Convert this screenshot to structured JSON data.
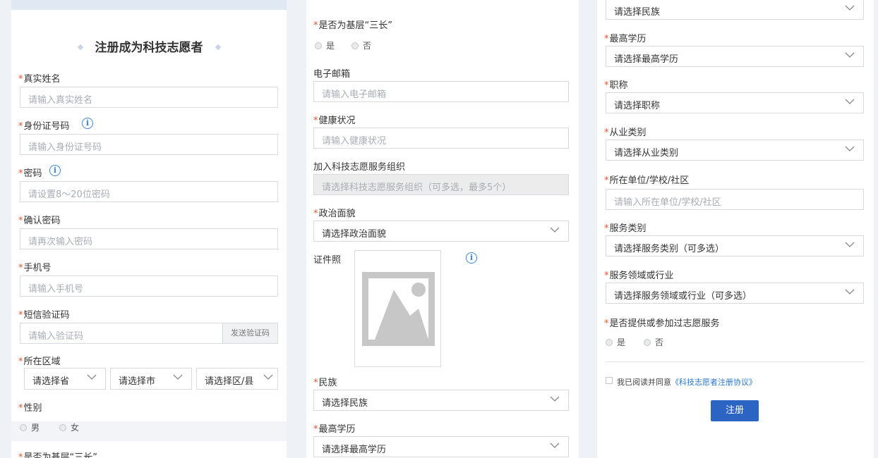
{
  "left_panel": {
    "title": "注册成为科技志愿者",
    "fields": {
      "real_name": {
        "label": "真实姓名",
        "placeholder": "请输入真实姓名"
      },
      "id_number": {
        "label": "身份证号码",
        "placeholder": "请输入身份证号码"
      },
      "password": {
        "label": "密码",
        "placeholder": "请设置8～20位密码"
      },
      "confirm_password": {
        "label": "确认密码",
        "placeholder": "请再次输入密码"
      },
      "phone": {
        "label": "手机号",
        "placeholder": "请输入手机号"
      },
      "sms_code": {
        "label": "短信验证码",
        "placeholder": "请输入验证码",
        "send_button": "发送验证码"
      },
      "region": {
        "label": "所在区域",
        "province": "请选择省",
        "city": "请选择市",
        "district": "请选择区/县"
      },
      "gender": {
        "label": "性别",
        "options": [
          "男",
          "女"
        ]
      },
      "grassroots_cut": {
        "label": "是否为基层“三长”"
      }
    }
  },
  "middle_panel": {
    "grassroots": {
      "label": "是否为基层“三长”",
      "options": [
        "是",
        "否"
      ]
    },
    "email": {
      "label": "电子邮箱",
      "placeholder": "请输入电子邮箱"
    },
    "health": {
      "label": "健康状况",
      "placeholder": "请输入健康状况"
    },
    "organization": {
      "label": "加入科技志愿服务组织",
      "placeholder": "请选择科技志愿服务组织（可多选，最多5个）"
    },
    "political": {
      "label": "政治面貌",
      "value": "请选择政治面貌"
    },
    "id_photo": {
      "label": "证件照"
    },
    "ethnicity": {
      "label": "民族",
      "value": "请选择民族"
    },
    "education": {
      "label": "最高学历",
      "value": "请选择最高学历"
    }
  },
  "right_panel": {
    "ethnicity_cut": {
      "value": "请选择民族"
    },
    "education": {
      "label": "最高学历",
      "value": "请选择最高学历"
    },
    "title_rank": {
      "label": "职称",
      "value": "请选择职称"
    },
    "occupation": {
      "label": "从业类别",
      "value": "请选择从业类别"
    },
    "workplace": {
      "label": "所在单位/学校/社区",
      "placeholder": "请输入所在单位/学校/社区"
    },
    "service_type": {
      "label": "服务类别",
      "value": "请选择服务类别（可多选）"
    },
    "service_field": {
      "label": "服务领域或行业",
      "value": "请选择服务领域或行业（可多选）"
    },
    "volunteered": {
      "label": "是否提供或参加过志愿服务",
      "options": [
        "是",
        "否"
      ]
    },
    "agreement": {
      "prefix": "我已阅读并同意",
      "link": "《科技志愿者注册协议》"
    },
    "submit_label": "注册"
  },
  "colors": {
    "required": "#e9532b",
    "accent": "#2c64c4",
    "link": "#2b78d0",
    "info": "#3d86d8"
  },
  "icons": [
    "info-icon",
    "chevron-down-icon",
    "image-placeholder-icon"
  ]
}
